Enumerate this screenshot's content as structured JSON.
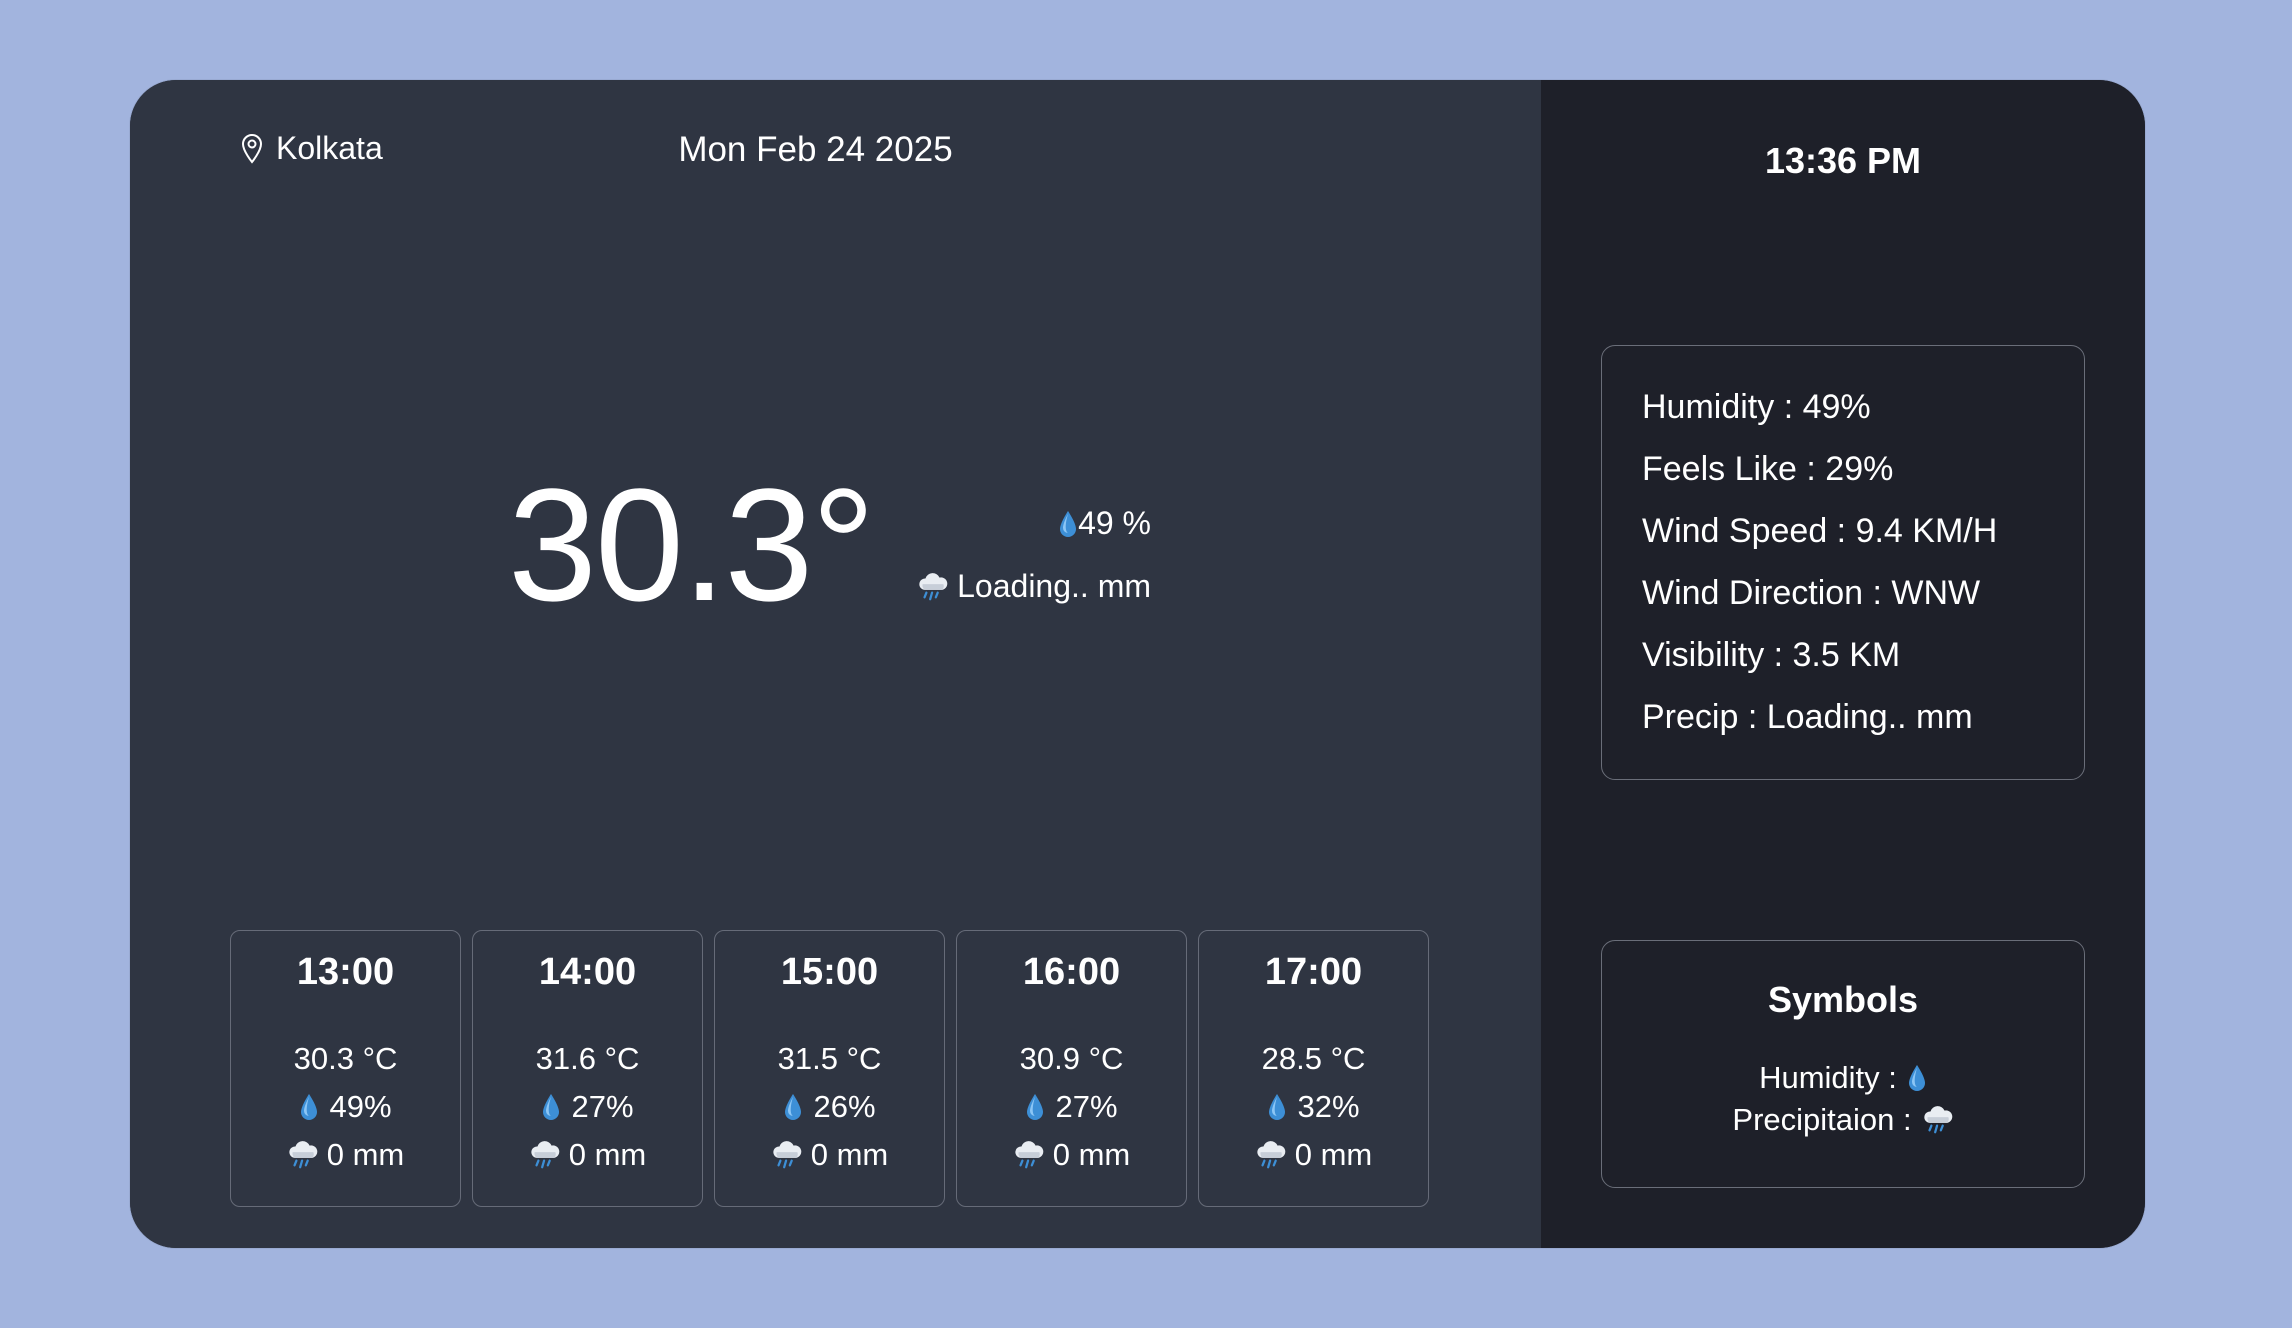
{
  "header": {
    "location": "Kolkata",
    "date": "Mon Feb 24 2025"
  },
  "current": {
    "temperature": "30.3°",
    "humidity": "49 %",
    "precip": "Loading.. mm"
  },
  "hourly": [
    {
      "time": "13:00",
      "temp": "30.3 °C",
      "humidity": "49%",
      "precip": "0 mm"
    },
    {
      "time": "14:00",
      "temp": "31.6 °C",
      "humidity": "27%",
      "precip": "0 mm"
    },
    {
      "time": "15:00",
      "temp": "31.5 °C",
      "humidity": "26%",
      "precip": "0 mm"
    },
    {
      "time": "16:00",
      "temp": "30.9 °C",
      "humidity": "27%",
      "precip": "0 mm"
    },
    {
      "time": "17:00",
      "temp": "28.5 °C",
      "humidity": "32%",
      "precip": "0 mm"
    }
  ],
  "sidebar": {
    "clock": "13:36 PM",
    "details": [
      "Humidity : 49%",
      "Feels Like : 29%",
      "Wind Speed : 9.4 KM/H",
      "Wind Direction : WNW",
      "Visibility : 3.5 KM",
      "Precip : Loading.. mm"
    ],
    "symbols": {
      "title": "Symbols",
      "humidity_label": "Humidity :",
      "precip_label": "Precipitaion :"
    }
  },
  "colors": {
    "page_bg": "#a2b4de",
    "main_bg": "#2f3542",
    "side_bg": "#1e2029",
    "text": "#ffffff",
    "drop": "#3d8fd6"
  },
  "icons": [
    "location-pin-icon",
    "water-drop-icon",
    "rain-cloud-icon"
  ]
}
